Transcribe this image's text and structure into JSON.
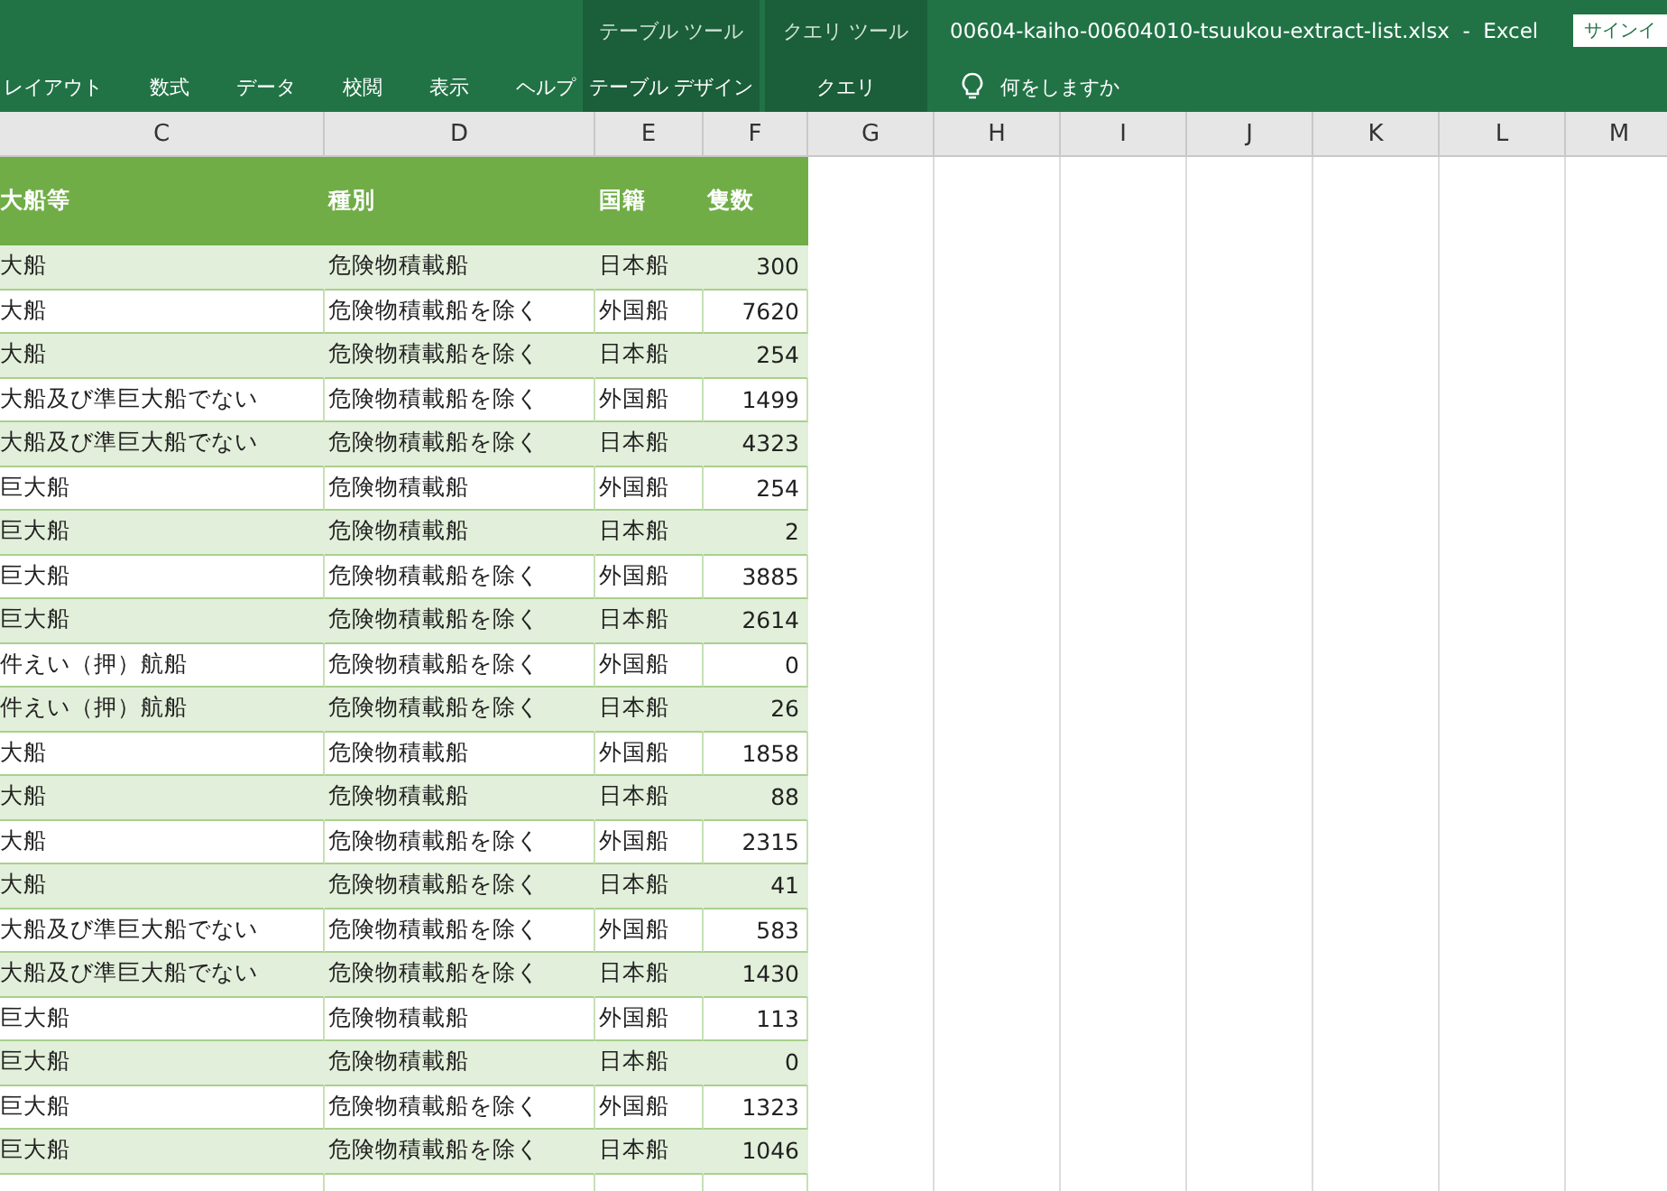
{
  "ribbon": {
    "tabs": [
      "レイアウト",
      "数式",
      "データ",
      "校閲",
      "表示",
      "ヘルプ"
    ],
    "context_groups": [
      {
        "title": "テーブル ツール",
        "tab": "テーブル デザイン"
      },
      {
        "title": "クエリ ツール",
        "tab": "クエリ"
      }
    ],
    "file_title": "00604-kaiho-00604010-tsuukou-extract-list.xlsx  -  Excel",
    "tell_me": "何をしますか",
    "signin": "サインイ"
  },
  "column_letters": [
    "C",
    "D",
    "E",
    "F",
    "G",
    "H",
    "I",
    "J",
    "K",
    "L",
    "M"
  ],
  "table": {
    "columns": [
      "大船等",
      "種別",
      "国籍",
      "隻数"
    ],
    "rows": [
      [
        "大船",
        "危険物積載船",
        "日本船",
        "300"
      ],
      [
        "大船",
        "危険物積載船を除く",
        "外国船",
        "7620"
      ],
      [
        "大船",
        "危険物積載船を除く",
        "日本船",
        "254"
      ],
      [
        "大船及び準巨大船でない",
        "危険物積載船を除く",
        "外国船",
        "1499"
      ],
      [
        "大船及び準巨大船でない",
        "危険物積載船を除く",
        "日本船",
        "4323"
      ],
      [
        "巨大船",
        "危険物積載船",
        "外国船",
        "254"
      ],
      [
        "巨大船",
        "危険物積載船",
        "日本船",
        "2"
      ],
      [
        "巨大船",
        "危険物積載船を除く",
        "外国船",
        "3885"
      ],
      [
        "巨大船",
        "危険物積載船を除く",
        "日本船",
        "2614"
      ],
      [
        "件えい（押）航船",
        "危険物積載船を除く",
        "外国船",
        "0"
      ],
      [
        "件えい（押）航船",
        "危険物積載船を除く",
        "日本船",
        "26"
      ],
      [
        "大船",
        "危険物積載船",
        "外国船",
        "1858"
      ],
      [
        "大船",
        "危険物積載船",
        "日本船",
        "88"
      ],
      [
        "大船",
        "危険物積載船を除く",
        "外国船",
        "2315"
      ],
      [
        "大船",
        "危険物積載船を除く",
        "日本船",
        "41"
      ],
      [
        "大船及び準巨大船でない",
        "危険物積載船を除く",
        "外国船",
        "583"
      ],
      [
        "大船及び準巨大船でない",
        "危険物積載船を除く",
        "日本船",
        "1430"
      ],
      [
        "巨大船",
        "危険物積載船",
        "外国船",
        "113"
      ],
      [
        "巨大船",
        "危険物積載船",
        "日本船",
        "0"
      ],
      [
        "巨大船",
        "危険物積載船を除く",
        "外国船",
        "1323"
      ],
      [
        "巨大船",
        "危険物積載船を除く",
        "日本船",
        "1046"
      ]
    ]
  }
}
